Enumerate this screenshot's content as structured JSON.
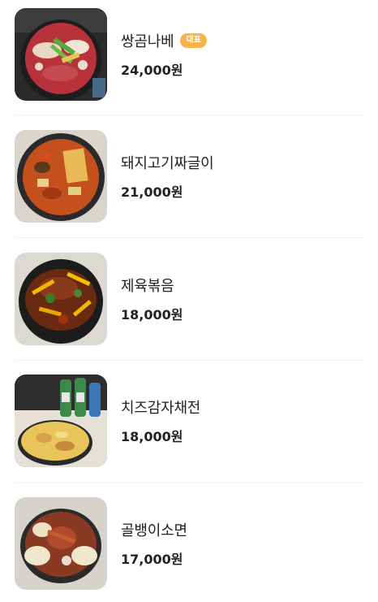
{
  "menu": {
    "items": [
      {
        "name": "쌍곰나베",
        "badge": "대표",
        "price": "24,000원"
      },
      {
        "name": "돼지고기짜글이",
        "badge": null,
        "price": "21,000원"
      },
      {
        "name": "제육볶음",
        "badge": null,
        "price": "18,000원"
      },
      {
        "name": "치즈감자채전",
        "badge": null,
        "price": "18,000원"
      },
      {
        "name": "골뱅이소면",
        "badge": null,
        "price": "17,000원"
      }
    ]
  },
  "colors": {
    "badge": "#f5b34a",
    "text": "#222222",
    "divider": "#f0f0f0"
  }
}
